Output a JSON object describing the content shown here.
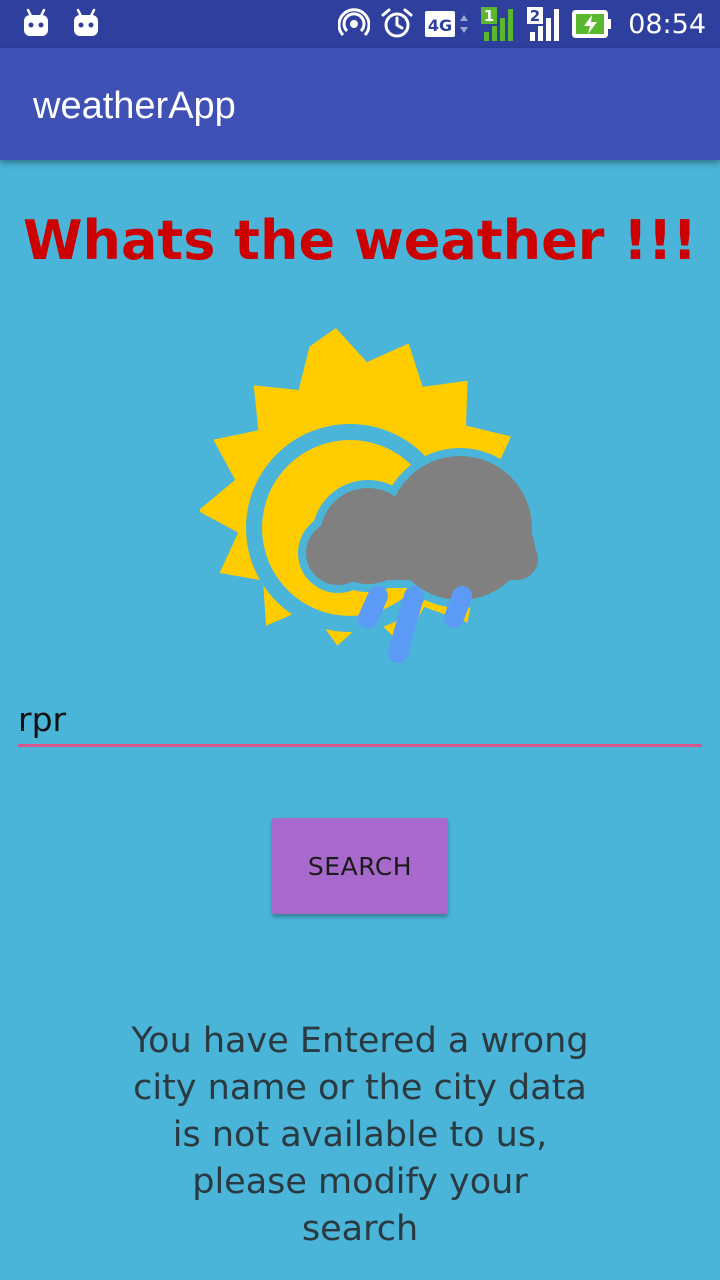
{
  "status_bar": {
    "time": "08:54",
    "network_type": "4G",
    "sim1_label": "1",
    "sim2_label": "2",
    "left_icons": [
      "android-notification-icon",
      "android-notification-icon"
    ],
    "right_icons": [
      "hotspot-icon",
      "alarm-icon",
      "4g-icon",
      "signal-sim1-icon",
      "signal-sim2-icon",
      "battery-charging-icon"
    ]
  },
  "app_bar": {
    "title": "weatherApp"
  },
  "main": {
    "heading": "Whats the weather !!!",
    "image_icon": "weather-sun-cloud-rain-icon",
    "city_input": {
      "value": "rpr",
      "placeholder": ""
    },
    "search_button_label": "SEARCH",
    "message": "You have Entered a wrong city name or the city data is not available to us, please modify your search"
  },
  "colors": {
    "status_bar": "#2e3f9e",
    "app_bar": "#3f51b5",
    "background": "#4ab5d8",
    "heading": "#cc0000",
    "input_underline": "#d9558e",
    "button": "#a869cc",
    "sun": "#ffcc00",
    "cloud": "#808080",
    "rain": "#5b9bf5"
  }
}
